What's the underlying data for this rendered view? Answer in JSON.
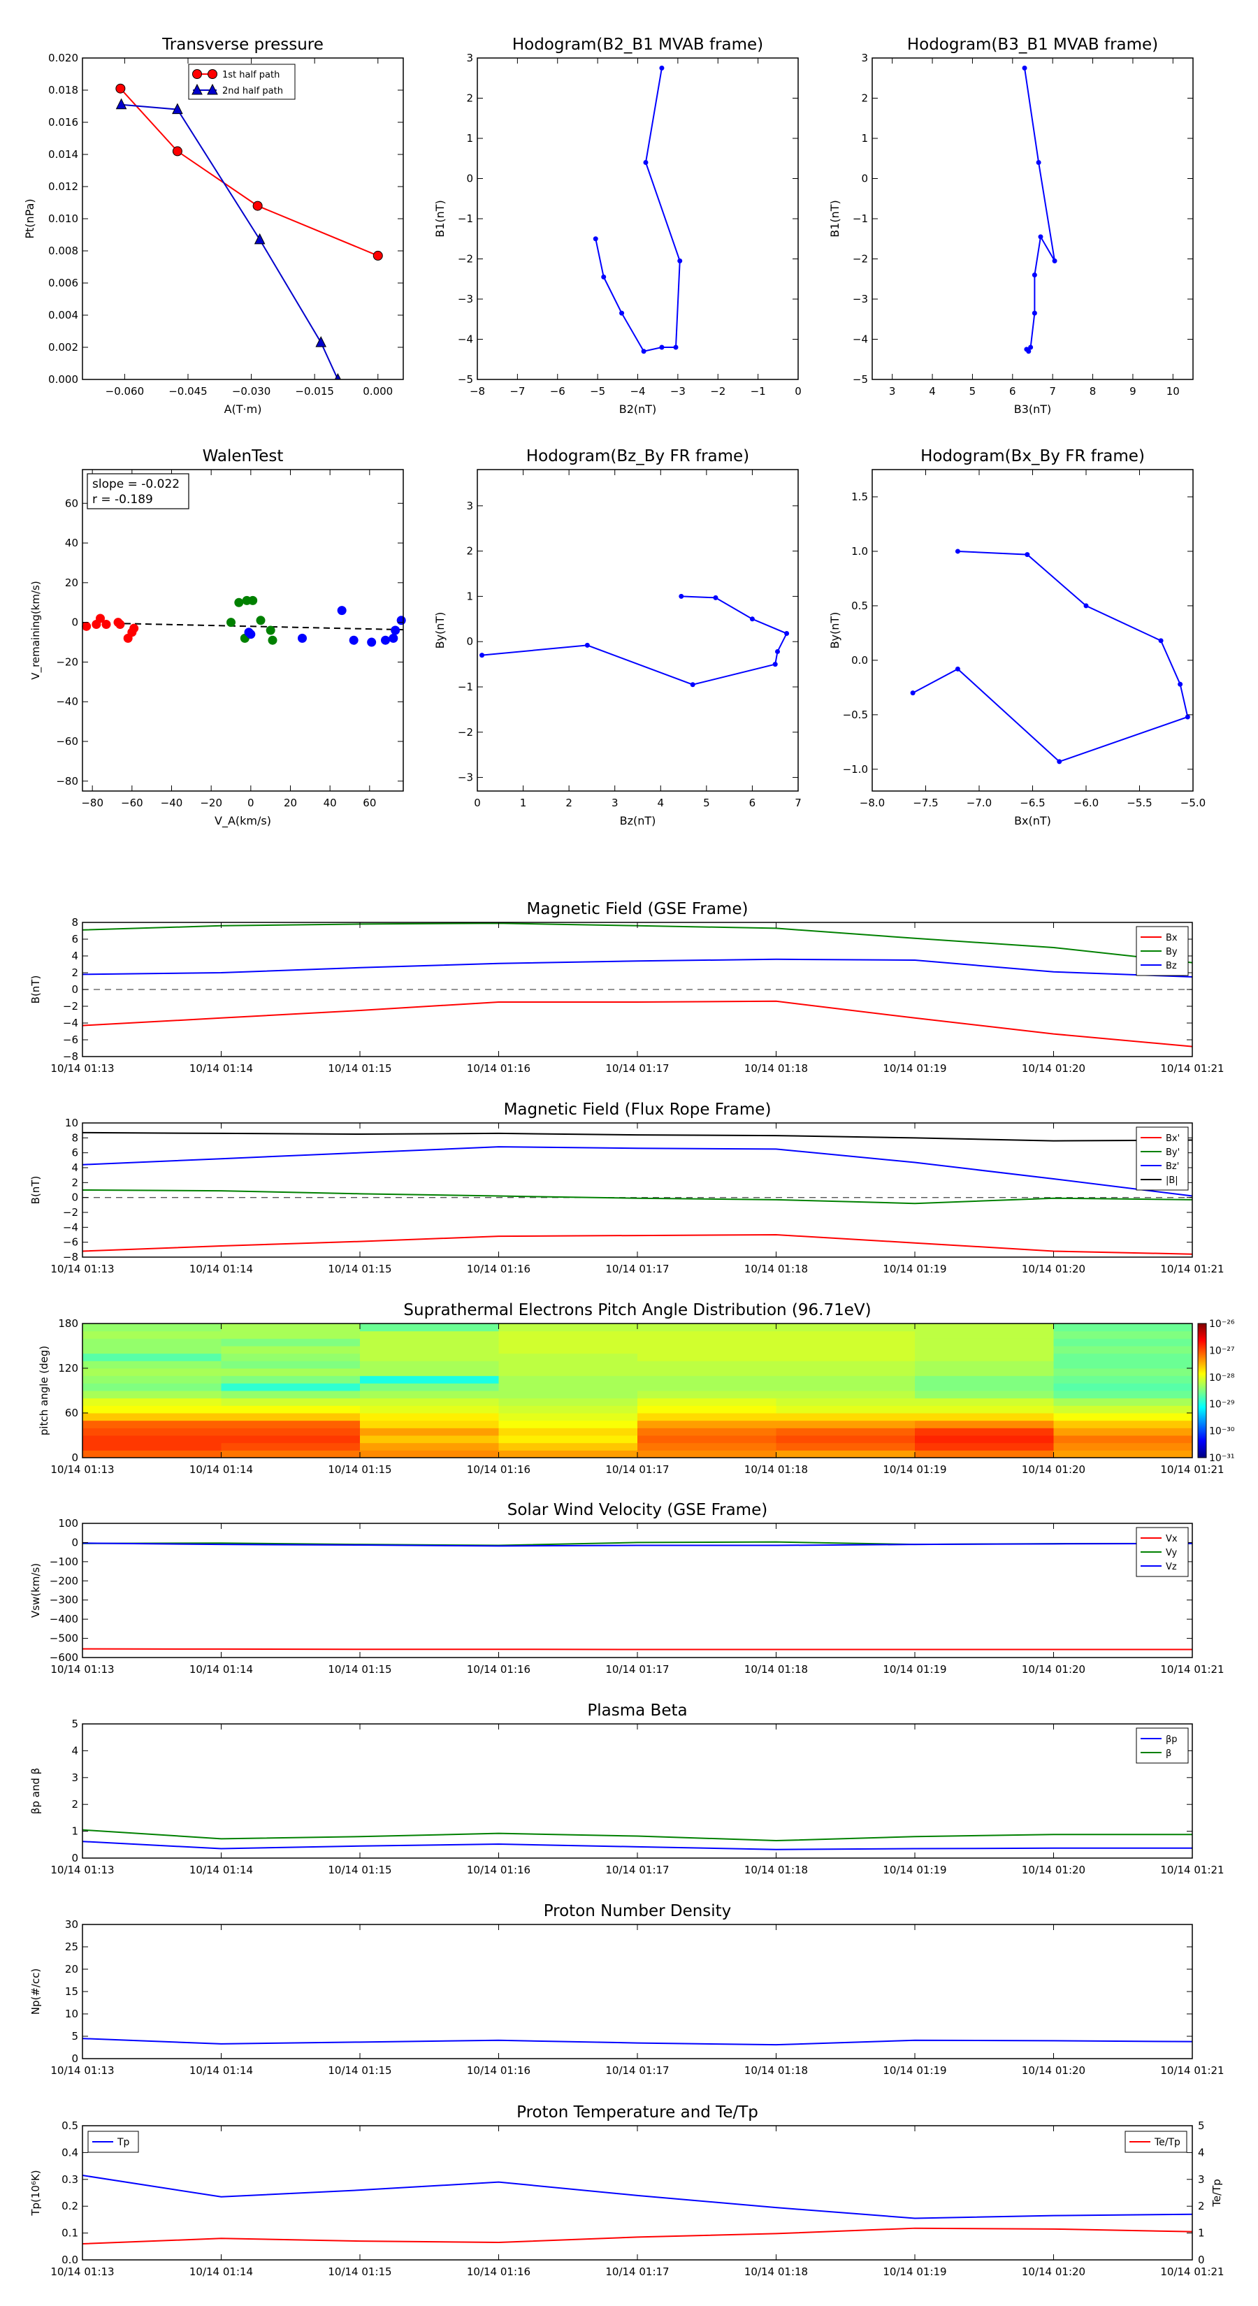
{
  "chart_data": [
    {
      "id": "tp",
      "type": "line",
      "title": "Transverse pressure",
      "xlabel": "A(T·m)",
      "ylabel": "Pt(nPa)",
      "xlim": [
        -0.07,
        0.006
      ],
      "ylim": [
        0,
        0.02
      ],
      "xticks": [
        -0.06,
        -0.045,
        -0.03,
        -0.015,
        0.0
      ],
      "xtick_labels": [
        "−0.060",
        "−0.045",
        "−0.030",
        "−0.015",
        "0.000"
      ],
      "yticks": [
        0,
        0.002,
        0.004,
        0.006,
        0.008,
        0.01,
        0.012,
        0.014,
        0.016,
        0.018,
        0.02
      ],
      "ytick_labels": [
        "0.000",
        "0.002",
        "0.004",
        "0.006",
        "0.008",
        "0.010",
        "0.012",
        "0.014",
        "0.016",
        "0.018",
        "0.020"
      ],
      "legend": "top-center",
      "series": [
        {
          "name": "1st half path",
          "color": "#ff0000",
          "marker": "circle",
          "x": [
            -0.061,
            -0.0475,
            -0.0285,
            0.0
          ],
          "y": [
            0.0181,
            0.0142,
            0.0108,
            0.0077
          ]
        },
        {
          "name": "2nd half path",
          "color": "#0000cc",
          "marker": "triangle",
          "x": [
            -0.0608,
            -0.0475,
            -0.028,
            -0.0135,
            -0.0095
          ],
          "y": [
            0.0171,
            0.0168,
            0.0087,
            0.0023,
            0.0
          ]
        }
      ]
    },
    {
      "id": "h1",
      "type": "line",
      "title": "Hodogram(B2_B1 MVAB frame)",
      "xlabel": "B2(nT)",
      "ylabel": "B1(nT)",
      "xlim": [
        -8,
        0
      ],
      "ylim": [
        -5,
        3
      ],
      "xticks": [
        -8,
        -7,
        -6,
        -5,
        -4,
        -3,
        -2,
        -1,
        0
      ],
      "xtick_labels": [
        "−8",
        "−7",
        "−6",
        "−5",
        "−4",
        "−3",
        "−2",
        "−1",
        "0"
      ],
      "yticks": [
        -5,
        -4,
        -3,
        -2,
        -1,
        0,
        1,
        2,
        3
      ],
      "ytick_labels": [
        "−5",
        "−4",
        "−3",
        "−2",
        "−1",
        "0",
        "1",
        "2",
        "3"
      ],
      "series": [
        {
          "color": "#0000ff",
          "marker": "dot",
          "x": [
            -3.4,
            -3.8,
            -2.95,
            -3.05,
            -3.4,
            -3.85,
            -4.4,
            -4.85,
            -5.05
          ],
          "y": [
            2.75,
            0.4,
            -2.05,
            -4.2,
            -4.2,
            -4.3,
            -3.35,
            -2.45,
            -1.5
          ]
        }
      ]
    },
    {
      "id": "h2",
      "type": "line",
      "title": "Hodogram(B3_B1 MVAB frame)",
      "xlabel": "B3(nT)",
      "ylabel": "B1(nT)",
      "xlim": [
        2.5,
        10.5
      ],
      "ylim": [
        -5,
        3
      ],
      "xticks": [
        3,
        4,
        5,
        6,
        7,
        8,
        9,
        10
      ],
      "xtick_labels": [
        "3",
        "4",
        "5",
        "6",
        "7",
        "8",
        "9",
        "10"
      ],
      "yticks": [
        -5,
        -4,
        -3,
        -2,
        -1,
        0,
        1,
        2,
        3
      ],
      "ytick_labels": [
        "−5",
        "−4",
        "−3",
        "−2",
        "−1",
        "0",
        "1",
        "2",
        "3"
      ],
      "series": [
        {
          "color": "#0000ff",
          "marker": "dot",
          "x": [
            6.3,
            6.65,
            7.05,
            6.7,
            6.55,
            6.55,
            6.45,
            6.4,
            6.35
          ],
          "y": [
            2.75,
            0.4,
            -2.05,
            -1.45,
            -2.4,
            -3.35,
            -4.2,
            -4.3,
            -4.25
          ]
        }
      ]
    },
    {
      "id": "walen",
      "type": "scatter",
      "title": "WalenTest",
      "xlabel": "V_A(km/s)",
      "ylabel": "V_remaining(km/s)",
      "xlim": [
        -85,
        77
      ],
      "ylim": [
        -85,
        77
      ],
      "xticks": [
        -80,
        -60,
        -40,
        -20,
        0,
        20,
        40,
        60
      ],
      "xtick_labels": [
        "−80",
        "−60",
        "−40",
        "−20",
        "0",
        "20",
        "40",
        "60"
      ],
      "yticks": [
        -80,
        -60,
        -40,
        -20,
        0,
        20,
        40,
        60
      ],
      "ytick_labels": [
        "−80",
        "−60",
        "−40",
        "−20",
        "0",
        "20",
        "40",
        "60"
      ],
      "annotation": [
        "slope = -0.022",
        "r = -0.189"
      ],
      "fit": {
        "slope": -0.022,
        "intercept": -2,
        "x": [
          -85,
          77
        ]
      },
      "series": [
        {
          "color": "#ff0000",
          "x": [
            -83,
            -78,
            -76,
            -73,
            -67,
            -66,
            -62,
            -60,
            -59
          ],
          "y": [
            -2,
            -1,
            2,
            -1,
            0,
            -1,
            -8,
            -5,
            -3
          ]
        },
        {
          "color": "#008000",
          "x": [
            -10,
            -6,
            -3,
            -2,
            1,
            5,
            10,
            11
          ],
          "y": [
            0,
            10,
            -8,
            11,
            11,
            1,
            -4,
            -9
          ]
        },
        {
          "color": "#0000ff",
          "x": [
            -1,
            0,
            26,
            46,
            52,
            61,
            68,
            72,
            73,
            76
          ],
          "y": [
            -5,
            -6,
            -8,
            6,
            -9,
            -10,
            -9,
            -8,
            -4,
            1
          ]
        }
      ]
    },
    {
      "id": "h3",
      "type": "line",
      "title": "Hodogram(Bz_By FR frame)",
      "xlabel": "Bz(nT)",
      "ylabel": "By(nT)",
      "xlim": [
        0,
        7
      ],
      "ylim": [
        -3.3,
        3.8
      ],
      "xticks": [
        0,
        1,
        2,
        3,
        4,
        5,
        6,
        7
      ],
      "xtick_labels": [
        "0",
        "1",
        "2",
        "3",
        "4",
        "5",
        "6",
        "7"
      ],
      "yticks": [
        -3,
        -2,
        -1,
        0,
        1,
        2,
        3
      ],
      "ytick_labels": [
        "−3",
        "−2",
        "−1",
        "0",
        "1",
        "2",
        "3"
      ],
      "series": [
        {
          "color": "#0000ff",
          "marker": "dot",
          "x": [
            4.45,
            5.2,
            6.0,
            6.75,
            6.55,
            6.5,
            4.7,
            2.4,
            0.1
          ],
          "y": [
            1.0,
            0.97,
            0.5,
            0.18,
            -0.22,
            -0.5,
            -0.95,
            -0.08,
            -0.3
          ]
        }
      ]
    },
    {
      "id": "h4",
      "type": "line",
      "title": "Hodogram(Bx_By FR frame)",
      "xlabel": "Bx(nT)",
      "ylabel": "By(nT)",
      "xlim": [
        -8,
        -5
      ],
      "ylim": [
        -1.2,
        1.75
      ],
      "xticks": [
        -8,
        -7.5,
        -7,
        -6.5,
        -6,
        -5.5,
        -5
      ],
      "xtick_labels": [
        "−8.0",
        "−7.5",
        "−7.0",
        "−6.5",
        "−6.0",
        "−5.5",
        "−5.0"
      ],
      "yticks": [
        -1.0,
        -0.5,
        0.0,
        0.5,
        1.0,
        1.5
      ],
      "ytick_labels": [
        "−1.0",
        "−0.5",
        "0.0",
        "0.5",
        "1.0",
        "1.5"
      ],
      "series": [
        {
          "color": "#0000ff",
          "marker": "dot",
          "x": [
            -7.2,
            -6.55,
            -6.0,
            -5.3,
            -5.12,
            -5.05,
            -6.25,
            -7.2,
            -7.62
          ],
          "y": [
            1.0,
            0.97,
            0.5,
            0.18,
            -0.22,
            -0.52,
            -0.93,
            -0.08,
            -0.3
          ]
        }
      ]
    },
    {
      "id": "bgse",
      "type": "line",
      "title": "Magnetic Field (GSE Frame)",
      "ylabel": "B(nT)",
      "ylim": [
        -8,
        8
      ],
      "yticks": [
        -8,
        -6,
        -4,
        -2,
        0,
        2,
        4,
        6,
        8
      ],
      "ytick_labels": [
        "−8",
        "−6",
        "−4",
        "−2",
        "0",
        "2",
        "4",
        "6",
        "8"
      ],
      "zero_line": true,
      "legend": "top-right",
      "series": [
        {
          "name": "Bx",
          "color": "#ff0000",
          "values": [
            -4.3,
            -3.4,
            -2.5,
            -1.5,
            -1.5,
            -1.4,
            -3.4,
            -5.3,
            -6.8
          ]
        },
        {
          "name": "By",
          "color": "#008000",
          "values": [
            7.1,
            7.6,
            7.8,
            7.9,
            7.6,
            7.3,
            6.1,
            5.0,
            3.2
          ]
        },
        {
          "name": "Bz",
          "color": "#0000ff",
          "values": [
            1.8,
            2.0,
            2.6,
            3.1,
            3.4,
            3.6,
            3.5,
            2.1,
            1.5
          ]
        }
      ]
    },
    {
      "id": "bfr",
      "type": "line",
      "title": "Magnetic Field (Flux Rope Frame)",
      "ylabel": "B(nT)",
      "ylim": [
        -8,
        10
      ],
      "yticks": [
        -8,
        -6,
        -4,
        -2,
        0,
        2,
        4,
        6,
        8,
        10
      ],
      "ytick_labels": [
        "−8",
        "−6",
        "−4",
        "−2",
        "0",
        "2",
        "4",
        "6",
        "8",
        "10"
      ],
      "zero_line": true,
      "legend": "right",
      "series": [
        {
          "name": "Bx'",
          "color": "#ff0000",
          "values": [
            -7.2,
            -6.5,
            -5.9,
            -5.2,
            -5.1,
            -5.0,
            -6.1,
            -7.2,
            -7.6
          ]
        },
        {
          "name": "By'",
          "color": "#008000",
          "values": [
            1.0,
            0.9,
            0.5,
            0.2,
            -0.1,
            -0.3,
            -0.8,
            -0.1,
            -0.3
          ]
        },
        {
          "name": "Bz'",
          "color": "#0000ff",
          "values": [
            4.4,
            5.2,
            6.0,
            6.8,
            6.6,
            6.5,
            4.7,
            2.5,
            0.2
          ]
        },
        {
          "name": "|B|",
          "color": "#000000",
          "values": [
            8.7,
            8.6,
            8.5,
            8.6,
            8.4,
            8.3,
            8.0,
            7.6,
            7.7
          ]
        }
      ]
    },
    {
      "id": "pad",
      "type": "heatmap",
      "title": "Suprathermal Electrons Pitch Angle Distribution (96.71eV)",
      "ylabel": "pitch angle (deg)",
      "ylim": [
        0,
        180
      ],
      "yticks": [
        0,
        60,
        120,
        180
      ],
      "ytick_labels": [
        "0",
        "60",
        "120",
        "180"
      ],
      "colorbar_labels": [
        "10⁻²⁶",
        "10⁻²⁷",
        "10⁻²⁸",
        "10⁻²⁹",
        "10⁻³⁰",
        "10⁻³¹"
      ],
      "colorbar_range": [
        -31,
        -26
      ],
      "values": [
        [
          -27.1,
          -27.2,
          -27.3,
          -27.4,
          -27.3,
          -27.4,
          -27.2,
          -27.4
        ],
        [
          -26.9,
          -27.0,
          -27.4,
          -27.6,
          -27.2,
          -27.1,
          -26.9,
          -27.3
        ],
        [
          -26.9,
          -26.9,
          -27.6,
          -27.8,
          -27.1,
          -27.0,
          -26.8,
          -27.2
        ],
        [
          -27.0,
          -27.0,
          -27.4,
          -27.7,
          -27.2,
          -27.1,
          -26.9,
          -27.4
        ],
        [
          -27.1,
          -27.1,
          -27.7,
          -27.9,
          -27.4,
          -27.4,
          -27.3,
          -27.6
        ],
        [
          -27.6,
          -27.6,
          -27.8,
          -28.0,
          -27.7,
          -27.7,
          -27.7,
          -27.9
        ],
        [
          -27.9,
          -27.9,
          -28.0,
          -28.1,
          -27.9,
          -28.0,
          -28.0,
          -28.1
        ],
        [
          -28.0,
          -28.1,
          -28.1,
          -28.2,
          -28.0,
          -28.1,
          -28.1,
          -28.3
        ],
        [
          -28.3,
          -28.4,
          -28.3,
          -28.3,
          -28.2,
          -28.2,
          -28.4,
          -28.6
        ],
        [
          -28.5,
          -28.9,
          -28.5,
          -28.3,
          -28.3,
          -28.3,
          -28.5,
          -28.7
        ],
        [
          -28.4,
          -28.5,
          -29.0,
          -28.3,
          -28.3,
          -28.3,
          -28.5,
          -28.6
        ],
        [
          -28.3,
          -28.3,
          -28.3,
          -28.2,
          -28.2,
          -28.2,
          -28.3,
          -28.5
        ],
        [
          -28.4,
          -28.5,
          -28.3,
          -28.2,
          -28.2,
          -28.2,
          -28.3,
          -28.6
        ],
        [
          -28.7,
          -28.4,
          -28.2,
          -28.2,
          -28.1,
          -28.1,
          -28.2,
          -28.6
        ],
        [
          -28.4,
          -28.3,
          -28.2,
          -28.1,
          -28.1,
          -28.1,
          -28.2,
          -28.5
        ],
        [
          -28.4,
          -28.5,
          -28.2,
          -28.1,
          -28.1,
          -28.1,
          -28.2,
          -28.6
        ],
        [
          -28.3,
          -28.3,
          -28.2,
          -28.1,
          -28.1,
          -28.1,
          -28.2,
          -28.5
        ],
        [
          -28.4,
          -28.3,
          -28.6,
          -28.2,
          -28.2,
          -28.2,
          -28.2,
          -28.6
        ]
      ]
    },
    {
      "id": "vsw",
      "type": "line",
      "title": "Solar Wind Velocity (GSE Frame)",
      "ylabel": "Vsw(km/s)",
      "ylim": [
        -600,
        100
      ],
      "yticks": [
        -600,
        -500,
        -400,
        -300,
        -200,
        -100,
        0,
        100
      ],
      "ytick_labels": [
        "−600",
        "−500",
        "−400",
        "−300",
        "−200",
        "−100",
        "0",
        "100"
      ],
      "legend": "top-right",
      "series": [
        {
          "name": "Vx",
          "color": "#ff0000",
          "values": [
            -555,
            -556,
            -557,
            -557,
            -558,
            -558,
            -558,
            -558,
            -558
          ]
        },
        {
          "name": "Vy",
          "color": "#008000",
          "values": [
            -5,
            -3,
            -10,
            -15,
            0,
            3,
            -10,
            -6,
            -5
          ]
        },
        {
          "name": "Vz",
          "color": "#0000ff",
          "values": [
            -3,
            -10,
            -13,
            -18,
            -15,
            -15,
            -10,
            -7,
            -5
          ]
        }
      ]
    },
    {
      "id": "beta",
      "type": "line",
      "title": "Plasma Beta",
      "ylabel": "βp and β",
      "ylim": [
        0,
        5
      ],
      "yticks": [
        0,
        1,
        2,
        3,
        4,
        5
      ],
      "ytick_labels": [
        "0",
        "1",
        "2",
        "3",
        "4",
        "5"
      ],
      "legend": "top-right",
      "series": [
        {
          "name": "βp",
          "color": "#0000ff",
          "values": [
            0.62,
            0.35,
            0.45,
            0.52,
            0.42,
            0.32,
            0.35,
            0.37,
            0.37
          ]
        },
        {
          "name": "β",
          "color": "#008000",
          "values": [
            1.05,
            0.72,
            0.8,
            0.92,
            0.82,
            0.65,
            0.8,
            0.88,
            0.88
          ]
        }
      ]
    },
    {
      "id": "np",
      "type": "line",
      "title": "Proton Number Density",
      "ylabel": "Np(#/cc)",
      "ylim": [
        0,
        30
      ],
      "yticks": [
        0,
        5,
        10,
        15,
        20,
        25,
        30
      ],
      "ytick_labels": [
        "0",
        "5",
        "10",
        "15",
        "20",
        "25",
        "30"
      ],
      "series": [
        {
          "color": "#0000ff",
          "values": [
            4.5,
            3.3,
            3.7,
            4.1,
            3.5,
            3.1,
            4.1,
            4.0,
            3.8
          ]
        }
      ]
    },
    {
      "id": "tpt",
      "type": "line",
      "title": "Proton Temperature and Te/Tp",
      "ylabel": "Tp(10⁶K)",
      "ylabel_right": "Te/Tp",
      "ylim": [
        0,
        0.5
      ],
      "ylim_right": [
        0,
        5
      ],
      "yticks": [
        0,
        0.1,
        0.2,
        0.3,
        0.4,
        0.5
      ],
      "ytick_labels": [
        "0.0",
        "0.1",
        "0.2",
        "0.3",
        "0.4",
        "0.5"
      ],
      "yticks_right": [
        0,
        1,
        2,
        3,
        4,
        5
      ],
      "ytick_labels_right": [
        "0",
        "1",
        "2",
        "3",
        "4",
        "5"
      ],
      "legend": "top-left / top-right",
      "series": [
        {
          "name": "Tp",
          "axis": "left",
          "color": "#0000ff",
          "values": [
            0.315,
            0.235,
            0.26,
            0.29,
            0.24,
            0.195,
            0.155,
            0.165,
            0.17
          ]
        },
        {
          "name": "Te/Tp",
          "axis": "right",
          "color": "#ff0000",
          "values": [
            0.6,
            0.8,
            0.7,
            0.65,
            0.85,
            0.98,
            1.18,
            1.15,
            1.05
          ]
        }
      ]
    }
  ],
  "time_ticks": [
    "10/14 01:13",
    "10/14 01:14",
    "10/14 01:15",
    "10/14 01:16",
    "10/14 01:17",
    "10/14 01:18",
    "10/14 01:19",
    "10/14 01:20",
    "10/14 01:21"
  ]
}
